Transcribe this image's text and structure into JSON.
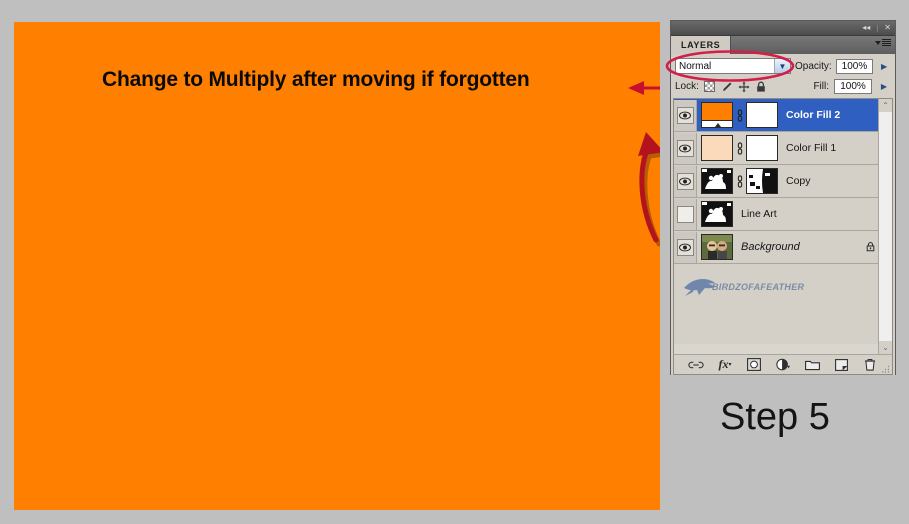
{
  "app": {
    "background_color": "#bfbfbf",
    "canvas_color": "#ff8000"
  },
  "canvas": {
    "annotation_text": "Change to Multiply after moving if forgotten",
    "annotation_color": "#0a0a0a",
    "arrow_color": "#c8102e"
  },
  "panel": {
    "titlebar": {
      "collapse_label": "◂◂",
      "separator": "|",
      "close_label": "✕"
    },
    "tab_label": "LAYERS",
    "blend": {
      "mode_value": "Normal",
      "mode_arrow": "▼",
      "opacity_label": "Opacity:",
      "opacity_value": "100%",
      "opacity_spinner": "▶"
    },
    "lock": {
      "label": "Lock:",
      "icons": [
        "lock-transparency-icon",
        "lock-image-icon",
        "lock-position-icon",
        "lock-all-icon"
      ],
      "fill_label": "Fill:",
      "fill_value": "100%",
      "fill_spinner": "▶"
    },
    "layers": [
      {
        "name": "Color Fill 2",
        "visible": true,
        "selected": true,
        "italic": false,
        "locked": false,
        "thumb_type": "solid-color",
        "thumb_color": "#ff8000",
        "has_link": true,
        "mask_thumb": "white"
      },
      {
        "name": "Color Fill 1",
        "visible": true,
        "selected": false,
        "italic": false,
        "locked": false,
        "thumb_type": "solid-color",
        "thumb_color": "#fbd9bb",
        "has_link": true,
        "mask_thumb": "white"
      },
      {
        "name": "Copy",
        "visible": true,
        "selected": false,
        "italic": false,
        "locked": false,
        "thumb_type": "line-art",
        "thumb_color": "#000000",
        "has_link": true,
        "mask_thumb": "line-art"
      },
      {
        "name": "Line Art",
        "visible": false,
        "selected": false,
        "italic": false,
        "locked": false,
        "thumb_type": "line-art",
        "thumb_color": "#000000",
        "has_link": false,
        "mask_thumb": "none"
      },
      {
        "name": "Background",
        "visible": true,
        "selected": false,
        "italic": true,
        "locked": true,
        "thumb_type": "photo",
        "thumb_color": "#6b7a48",
        "has_link": false,
        "mask_thumb": "none"
      }
    ],
    "watermark_text": "BIRDZOFAFEATHER",
    "scrollbar": {
      "up_arrow": "⌃",
      "down_arrow": "⌄"
    },
    "footer_icons": [
      "link-layers-icon",
      "layer-style-fx-icon",
      "add-layer-mask-icon",
      "new-adjustment-layer-icon",
      "new-group-icon",
      "new-layer-icon",
      "delete-layer-icon"
    ],
    "footer_fx_label": "fx"
  },
  "step": {
    "label": "Step 5"
  },
  "annotations": {
    "ellipse_color": "#d21f4a",
    "ellipse_target": "blend-mode-dropdown"
  }
}
